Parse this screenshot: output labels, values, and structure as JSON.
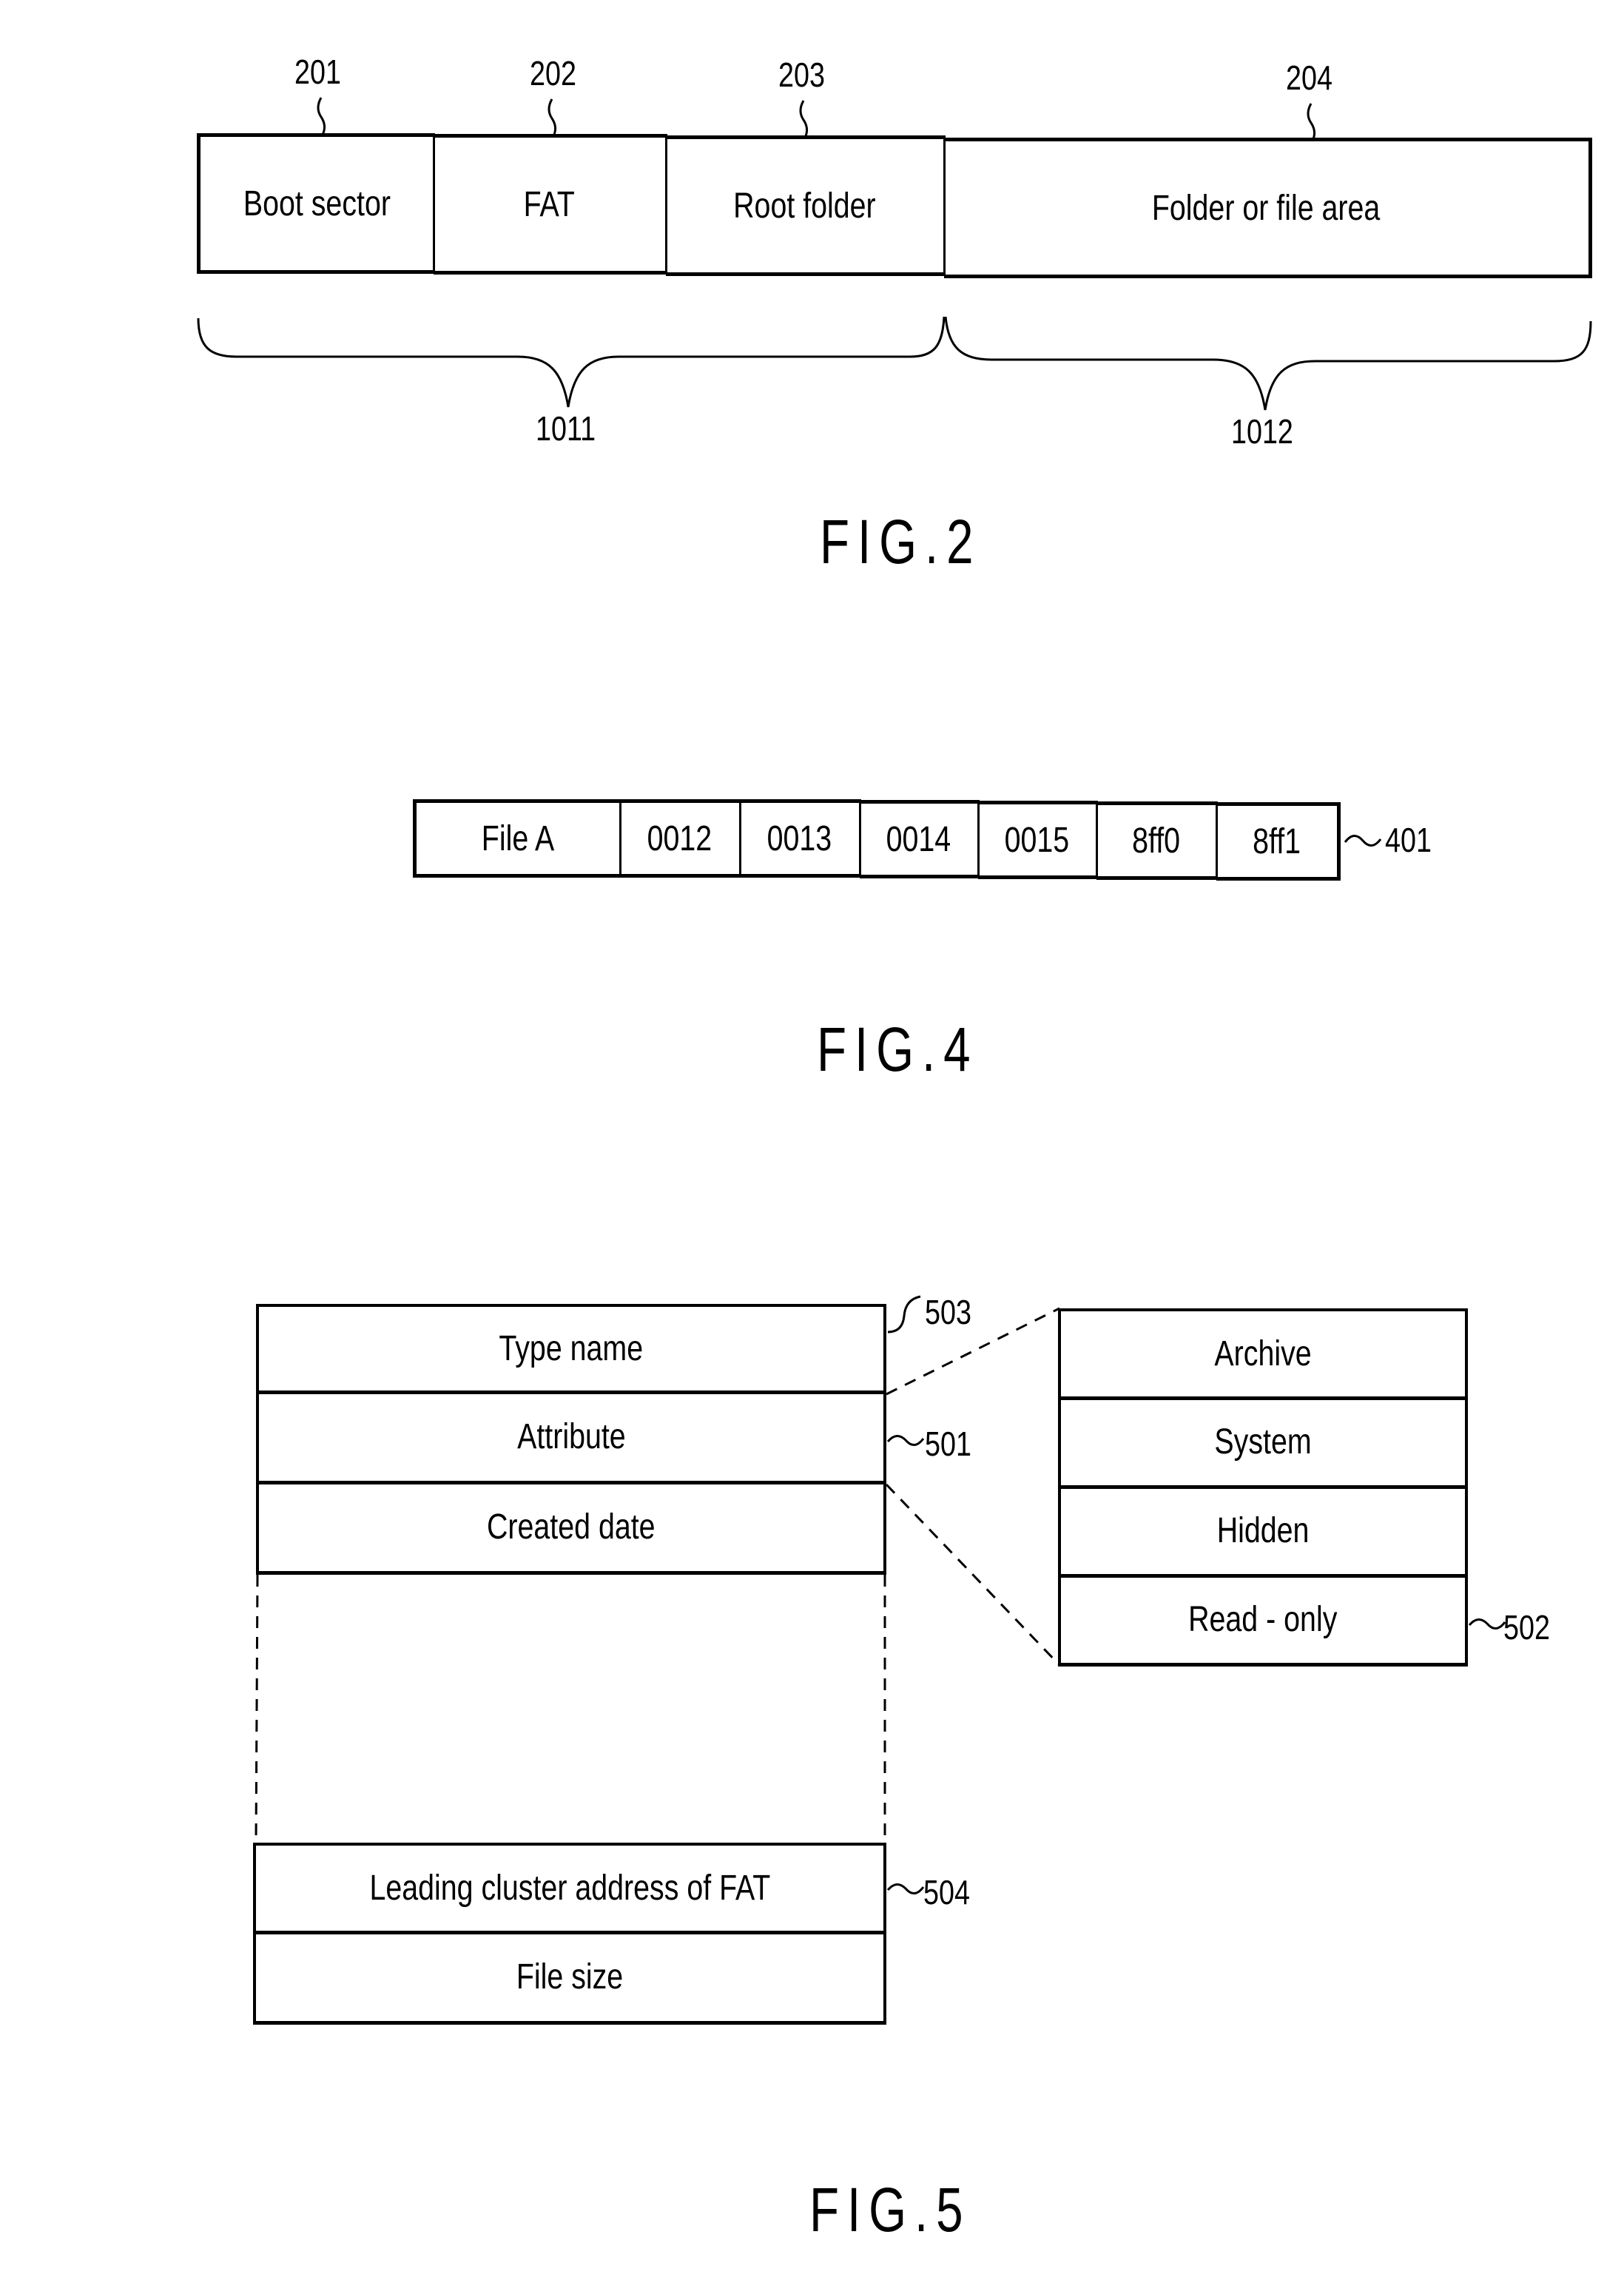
{
  "figures": [
    {
      "caption": "FIG.2",
      "segments": [
        {
          "ref": "201",
          "label": "Boot sector"
        },
        {
          "ref": "202",
          "label": "FAT"
        },
        {
          "ref": "203",
          "label": "Root folder"
        },
        {
          "ref": "204",
          "label": "Folder or file area"
        }
      ],
      "groups": [
        {
          "ref": "1011",
          "spans": "Boot sector, FAT, Root folder"
        },
        {
          "ref": "1012",
          "spans": "Folder or file area"
        }
      ]
    },
    {
      "caption": "FIG.4",
      "ref": "401",
      "entries": [
        "File A",
        "0012",
        "0013",
        "0014",
        "0015",
        "8ff0",
        "8ff1"
      ]
    },
    {
      "caption": "FIG.5",
      "entry_fields": [
        {
          "label": "Type name",
          "ref": "503"
        },
        {
          "label": "Attribute",
          "ref": "501"
        },
        {
          "label": "Created date",
          "ref": ""
        },
        {
          "label": "Leading cluster address of FAT",
          "ref": "504"
        },
        {
          "label": "File size",
          "ref": ""
        }
      ],
      "attribute_detail": {
        "ref": "502",
        "items": [
          "Archive",
          "System",
          "Hidden",
          "Read - only"
        ]
      }
    }
  ]
}
